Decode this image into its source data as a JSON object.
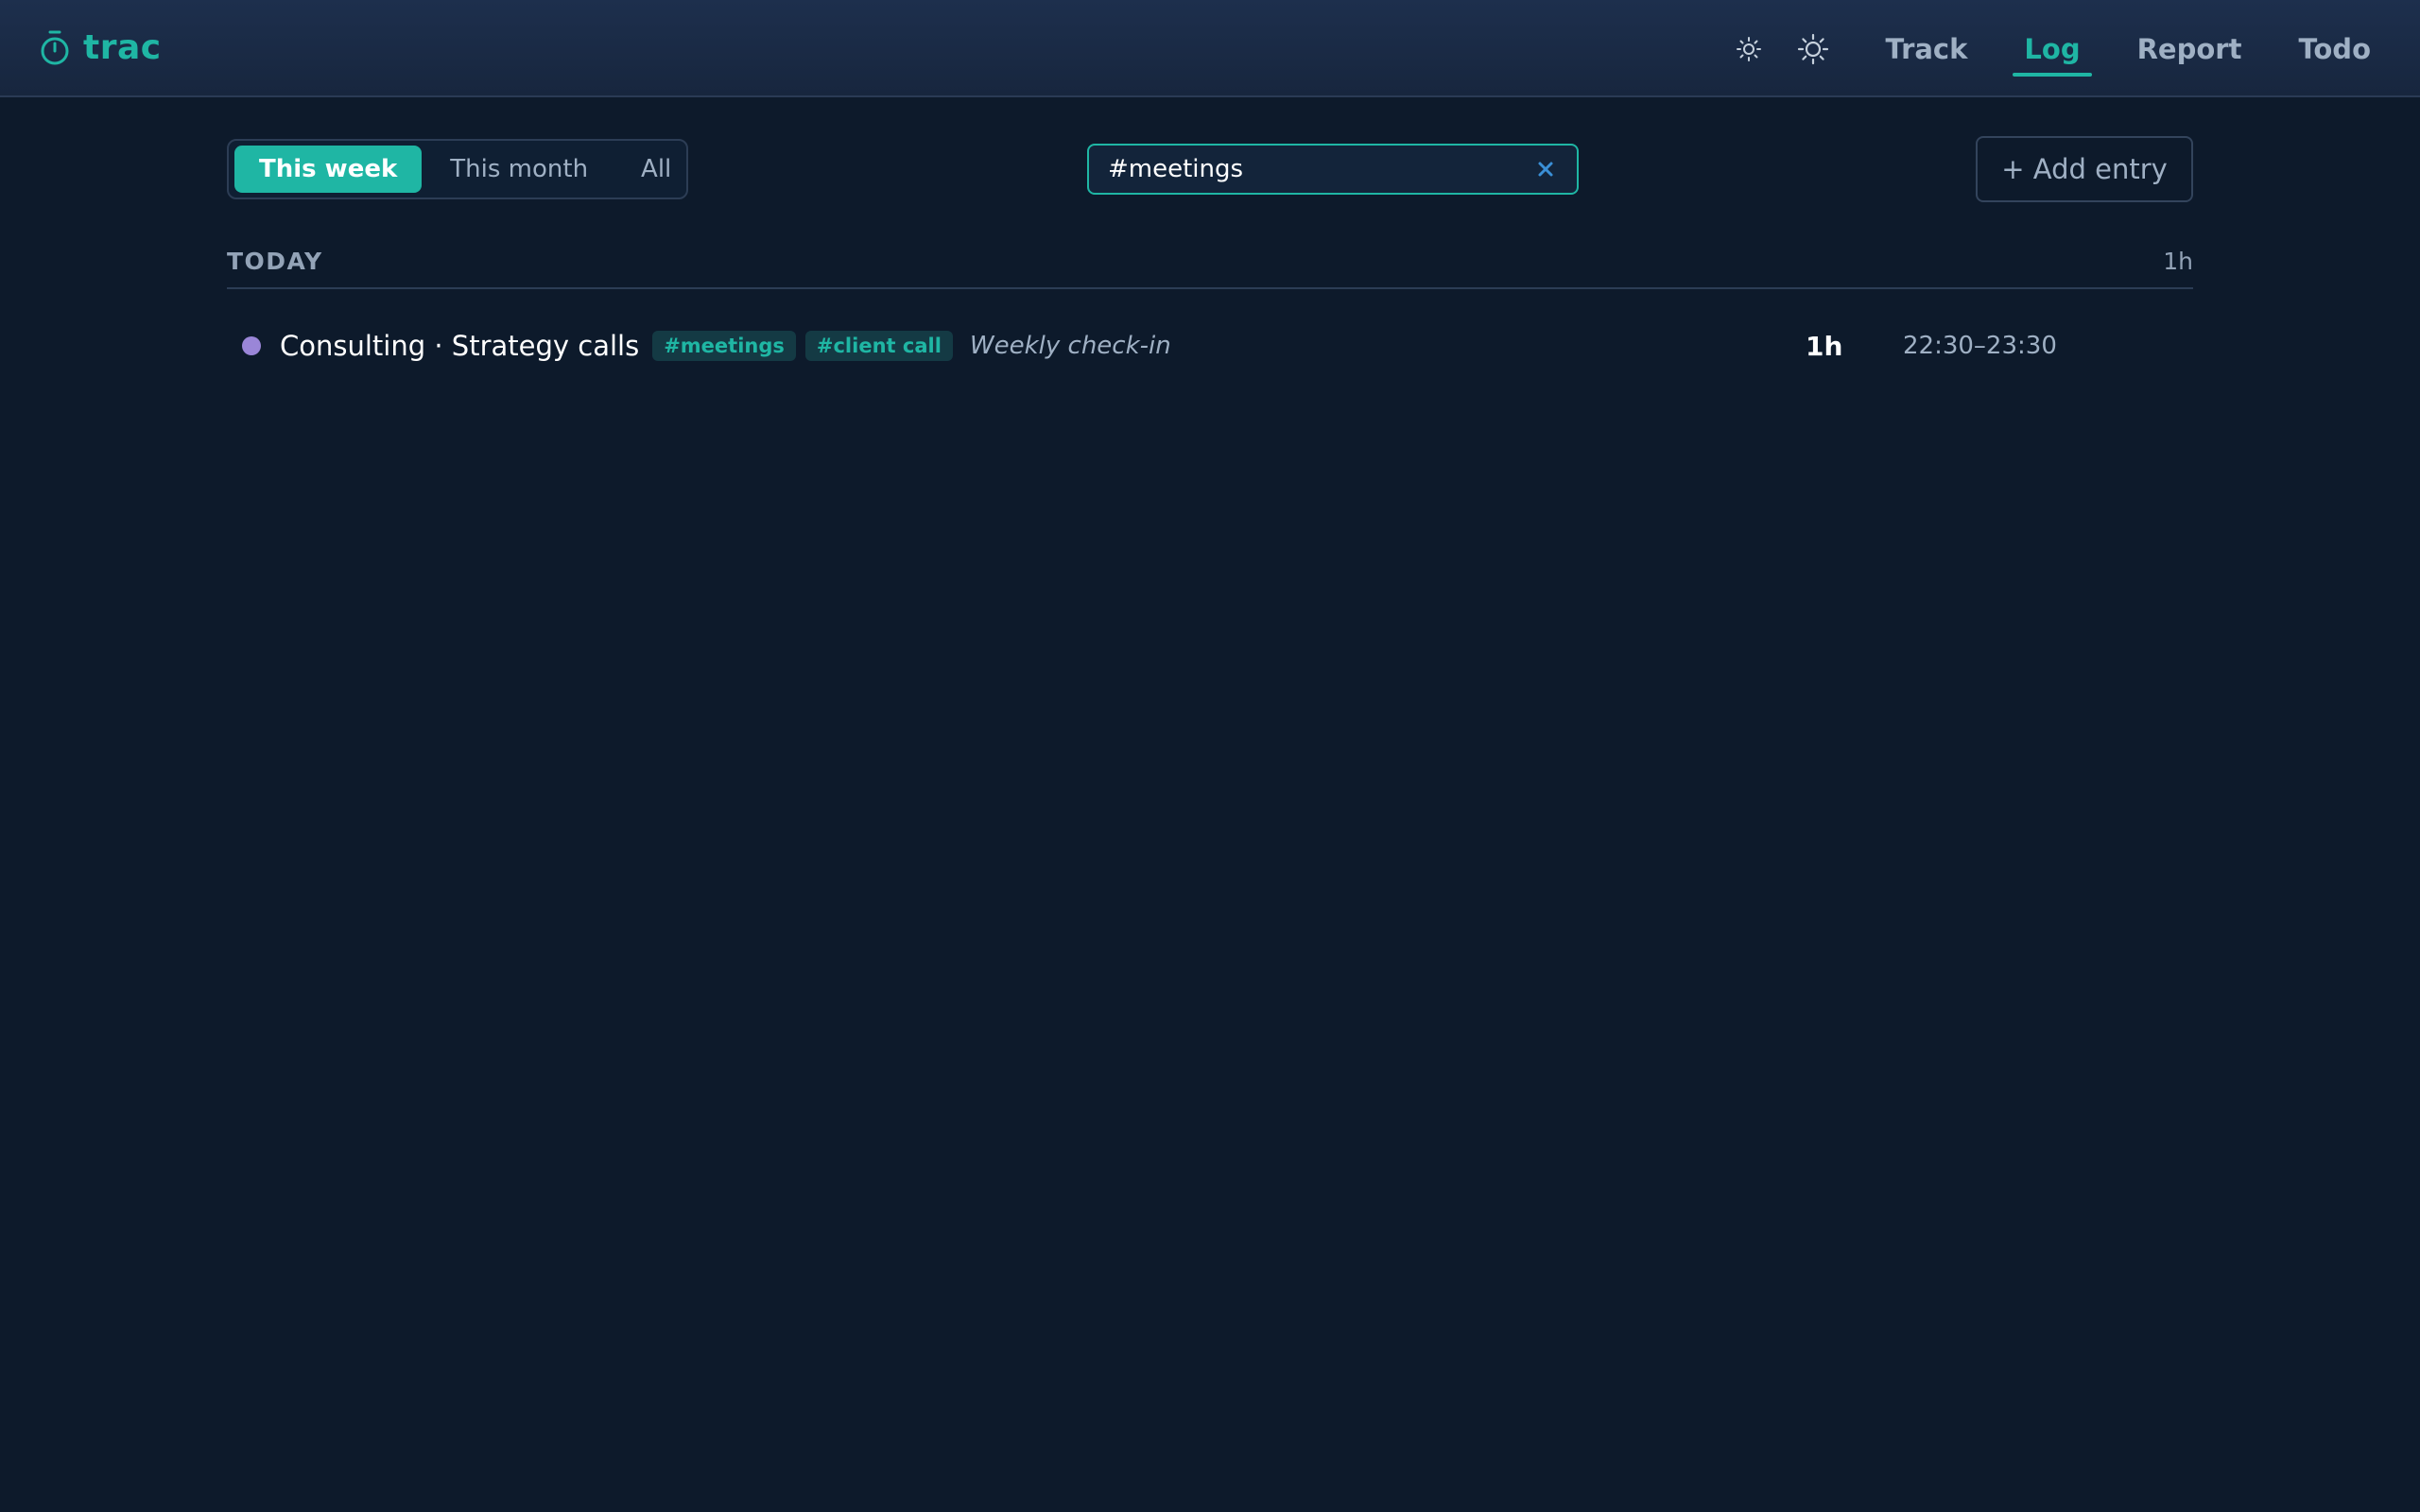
{
  "app": {
    "name": "trac",
    "icon": "stopwatch-icon",
    "accent_color": "#1fb6a4"
  },
  "header": {
    "theme_icons": [
      "sun-small-icon",
      "sun-icon"
    ],
    "nav": [
      {
        "label": "Track",
        "active": false
      },
      {
        "label": "Log",
        "active": true
      },
      {
        "label": "Report",
        "active": false
      },
      {
        "label": "Todo",
        "active": false
      }
    ]
  },
  "filters": {
    "ranges": [
      {
        "label": "This week",
        "active": true
      },
      {
        "label": "This month",
        "active": false
      },
      {
        "label": "All",
        "active": false
      }
    ],
    "search_value": "#meetings",
    "clear_icon": "close-icon",
    "add_label": "+ Add entry"
  },
  "log": {
    "groups": [
      {
        "label": "TODAY",
        "total": "1h",
        "entries": [
          {
            "title": "Consulting · Strategy calls",
            "dot_color": "#9a86d8",
            "tags": [
              "#meetings",
              "#client call"
            ],
            "note": "Weekly check-in",
            "duration": "1h",
            "time_range": "22:30–23:30"
          }
        ]
      }
    ]
  }
}
